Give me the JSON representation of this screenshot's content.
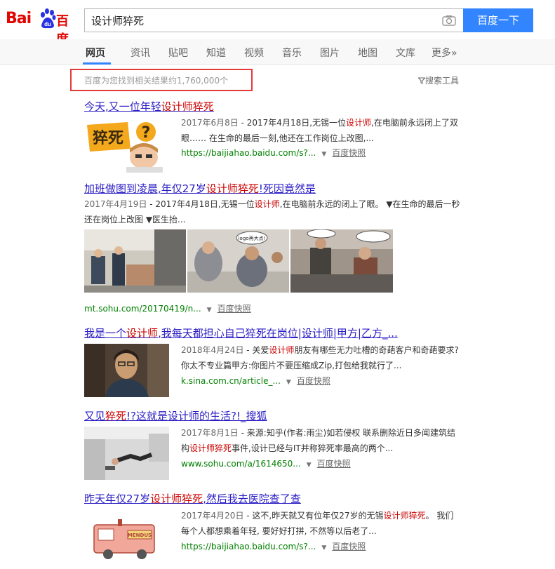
{
  "header": {
    "logo_text_1": "Bai",
    "logo_text_2": "du",
    "logo_text_3": "百度",
    "query": "设计师猝死",
    "search_button": "百度一下",
    "camera_icon": "camera-icon"
  },
  "tabs": [
    {
      "label": "网页",
      "active": true
    },
    {
      "label": "资讯"
    },
    {
      "label": "贴吧"
    },
    {
      "label": "知道"
    },
    {
      "label": "视频"
    },
    {
      "label": "音乐"
    },
    {
      "label": "图片"
    },
    {
      "label": "地图"
    },
    {
      "label": "文库"
    },
    {
      "label": "更多»"
    }
  ],
  "result_count": "百度为您找到相关结果约1,760,000个",
  "search_tools": "搜索工具",
  "colors": {
    "brand": "#e10602",
    "button": "#3385ff",
    "link": "#2a1dc4",
    "highlight": "#c00",
    "url": "#008000",
    "annotation_box": "#e53a3a"
  },
  "results": [
    {
      "title_pre": "今天,又一位年轻",
      "title_em": "设计师猝死",
      "title_post": "",
      "date": "2017年6月8日",
      "abstract_1": " - 2017年4月18日,无锡一位",
      "abstract_em": "设计师",
      "abstract_2": ",在电脑前永远闭上了双眼…… 在生命的最后一刻,他还在工作岗位上改图,...",
      "url": "https://baijiahao.baidu.com/s?...",
      "snapshot": "百度快照",
      "thumb_text": "猝死"
    },
    {
      "title_pre": "加班做图到凌晨,年仅27岁",
      "title_em": "设计师猝死",
      "title_post": "!死因竟然是",
      "date": "2017年4月19日",
      "abstract_1": " - 2017年4月18日,无锡一位",
      "abstract_em": "设计师",
      "abstract_2": ",在电脑前永远的闭上了眼。 ▼在生命的最后一秒还在岗位上改图 ▼医生抬...",
      "url": "mt.sohu.com/20170419/n...",
      "snapshot": "百度快照",
      "thumb_text": "logo再大点!"
    },
    {
      "title_pre": "我是一个",
      "title_em": "设计师",
      "title_post": ",我每天都担心自己猝死在岗位|设计师|甲方|乙方_...",
      "date": "2018年4月24日",
      "abstract_1": " - 关爱",
      "abstract_em": "设计师",
      "abstract_2": "朋友有哪些无力吐槽的奇葩客户和奇葩要求?你太不专业篇甲方:你图片不要压缩成Zip,打包给我就行了...",
      "url": "k.sina.com.cn/article_...",
      "snapshot": "百度快照"
    },
    {
      "title_pre": "又见",
      "title_em": "猝死",
      "title_post": "!?这就是设计师的生活?!_搜狐",
      "date": "2017年8月1日",
      "abstract_1": " - 来源:知乎(作者:雨尘)如若侵权 联系删除近日多闻建筑结构",
      "abstract_em": "设计师猝死",
      "abstract_2": "事件,设计已经与IT并称猝死率最高的两个...",
      "url": "www.sohu.com/a/1614650...",
      "snapshot": "百度快照"
    },
    {
      "title_pre": "昨天年仅27岁",
      "title_em": "设计师猝死",
      "title_post": ",然后我去医院查了查",
      "date": "2017年4月20日",
      "abstract_1": " - 这不,昨天就又有位年仅27岁的无锡",
      "abstract_em": "设计师猝死",
      "abstract_2": "。 我们每个人都想乘着年轻, 要好好打拼, 不然等以后老了...",
      "url": "https://baijiahao.baidu.com/s?...",
      "snapshot": "百度快照",
      "thumb_text": "MENDUS"
    }
  ]
}
